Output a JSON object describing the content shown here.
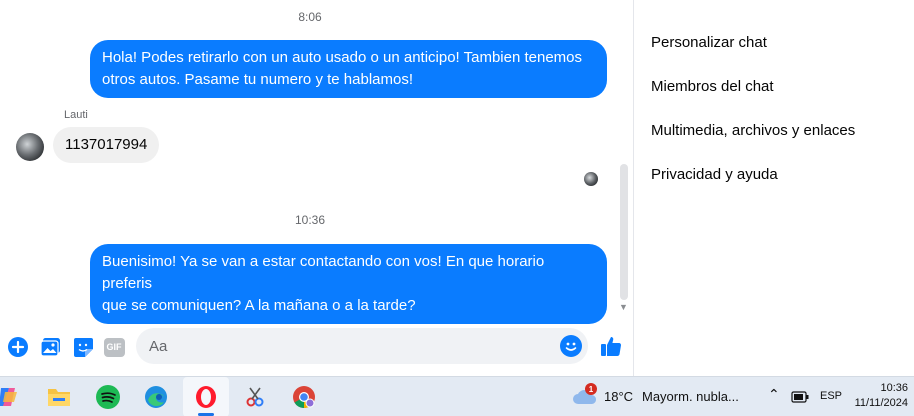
{
  "chat": {
    "timestamps": [
      "8:06",
      "10:36"
    ],
    "messages": [
      {
        "direction": "out",
        "text_line1": "Hola! Podes retirarlo con un auto usado o un anticipo! Tambien tenemos",
        "text_line2": "otros autos. Pasame tu numero y te hablamos!"
      },
      {
        "direction": "in",
        "sender": "Lauti",
        "text": "1137017994"
      },
      {
        "direction": "out",
        "text_line1": "Buenisimo! Ya se van a estar contactando con vos! En que horario preferis",
        "text_line2": "que se comuniquen? A la mañana o a la tarde?"
      }
    ]
  },
  "composer": {
    "placeholder": "Aa",
    "icons": [
      "plus-icon",
      "image-icon",
      "sticker-icon",
      "gif-icon",
      "emoji-icon",
      "like-icon"
    ],
    "gif_label": "GIF"
  },
  "sidebar": {
    "items": [
      {
        "label": "Personalizar chat"
      },
      {
        "label": "Miembros del chat"
      },
      {
        "label": "Multimedia, archivos y enlaces"
      },
      {
        "label": "Privacidad y ayuda"
      }
    ]
  },
  "taskbar": {
    "apps": [
      "copilot-icon",
      "file-explorer-icon",
      "spotify-icon",
      "edge-icon",
      "opera-icon",
      "snipping-tool-icon",
      "chrome-icon"
    ],
    "weather": {
      "temp": "18°C",
      "desc": "Mayorm. nubla...",
      "badge": "1"
    },
    "language": "ESP",
    "time": "10:36",
    "date": "11/11/2024"
  },
  "colors": {
    "accent": "#0a7cff",
    "incoming_bubble": "#f0f0f0",
    "taskbar": "#e3eaf3"
  }
}
